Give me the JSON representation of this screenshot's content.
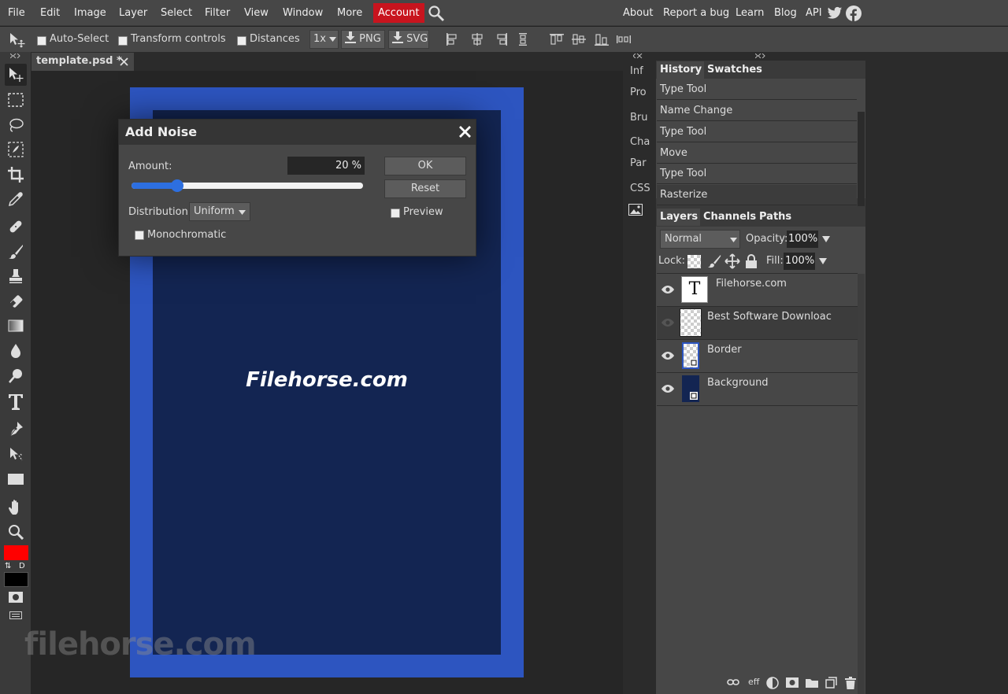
{
  "menu": {
    "items": [
      "File",
      "Edit",
      "Image",
      "Layer",
      "Select",
      "Filter",
      "View",
      "Window",
      "More"
    ],
    "account": "Account",
    "right": [
      "About",
      "Report a bug",
      "Learn",
      "Blog",
      "API"
    ]
  },
  "options": {
    "auto_select": "Auto-Select",
    "transform_controls": "Transform controls",
    "distances": "Distances",
    "zoom": "1x",
    "png": "PNG",
    "svg": "SVG"
  },
  "document": {
    "tab_title": "template.psd *",
    "canvas_text": "Filehorse.com",
    "frame_color": "#2d55c0",
    "inner_color": "#132552"
  },
  "dialog": {
    "title": "Add Noise",
    "amount_label": "Amount:",
    "amount_value": "20 %",
    "amount_fraction": 0.2,
    "distribution_label": "Distribution:",
    "distribution_value": "Uniform",
    "monochromatic": "Monochromatic",
    "ok": "OK",
    "reset": "Reset",
    "preview": "Preview"
  },
  "mini_panels": [
    "Inf",
    "Pro",
    "Bru",
    "Cha",
    "Par",
    "CSS"
  ],
  "history": {
    "tabs": [
      "History",
      "Swatches"
    ],
    "items": [
      "Type Tool",
      "Name Change",
      "Type Tool",
      "Move",
      "Type Tool",
      "Rasterize"
    ]
  },
  "layers": {
    "tabs": [
      "Layers",
      "Channels",
      "Paths"
    ],
    "blend_mode": "Normal",
    "opacity_label": "Opacity:",
    "opacity_value": "100%",
    "lock_label": "Lock:",
    "fill_label": "Fill:",
    "fill_value": "100%",
    "items": [
      {
        "name": "Filehorse.com"
      },
      {
        "name": "Best Software Downloac"
      },
      {
        "name": "Border"
      },
      {
        "name": "Background"
      }
    ],
    "footer": {
      "eff": "eff"
    }
  },
  "swap_label": "D",
  "watermark": "filehorse.com",
  "colors": {
    "foreground": "#ff0000",
    "background": "#000000",
    "account": "#c8141e"
  }
}
